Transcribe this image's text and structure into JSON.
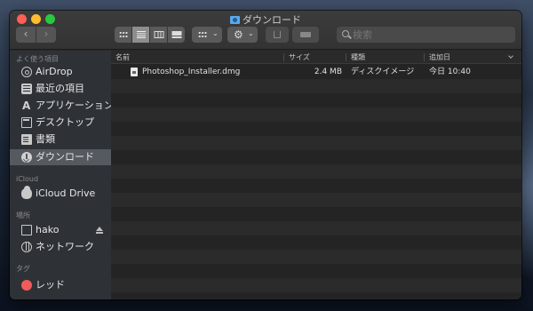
{
  "window": {
    "title": "ダウンロード",
    "colors": {
      "close": "#fe5f57",
      "minimize": "#febc2e",
      "zoom": "#28c840"
    }
  },
  "toolbar": {
    "back_label": "‹",
    "forward_label": "›",
    "view_modes": [
      "icon",
      "list",
      "column",
      "gallery"
    ],
    "selected_view": "list",
    "action_label": "⚙",
    "search_placeholder": "検索"
  },
  "sidebar": {
    "favorites_header": "よく使う項目",
    "favorites": [
      {
        "label": "AirDrop",
        "icon": "airdrop-icon"
      },
      {
        "label": "最近の項目",
        "icon": "recents-icon"
      },
      {
        "label": "アプリケーション",
        "icon": "applications-icon"
      },
      {
        "label": "デスクトップ",
        "icon": "desktop-icon"
      },
      {
        "label": "書類",
        "icon": "documents-icon"
      },
      {
        "label": "ダウンロード",
        "icon": "downloads-icon",
        "selected": true
      }
    ],
    "icloud_header": "iCloud",
    "icloud": [
      {
        "label": "iCloud Drive",
        "icon": "cloud-icon"
      }
    ],
    "locations_header": "場所",
    "locations": [
      {
        "label": "hako",
        "icon": "computer-icon",
        "ejectable": true
      },
      {
        "label": "ネットワーク",
        "icon": "network-icon"
      }
    ],
    "tags_header": "タグ",
    "tags": [
      {
        "label": "レッド",
        "color": "#f25b5b"
      }
    ]
  },
  "columns": {
    "name": "名前",
    "size": "サイズ",
    "kind": "種類",
    "date_added": "追加日"
  },
  "files": [
    {
      "name": "Photoshop_Installer.dmg",
      "size": "2.4 MB",
      "kind": "ディスクイメージ",
      "date_added": "今日 10:40"
    }
  ]
}
